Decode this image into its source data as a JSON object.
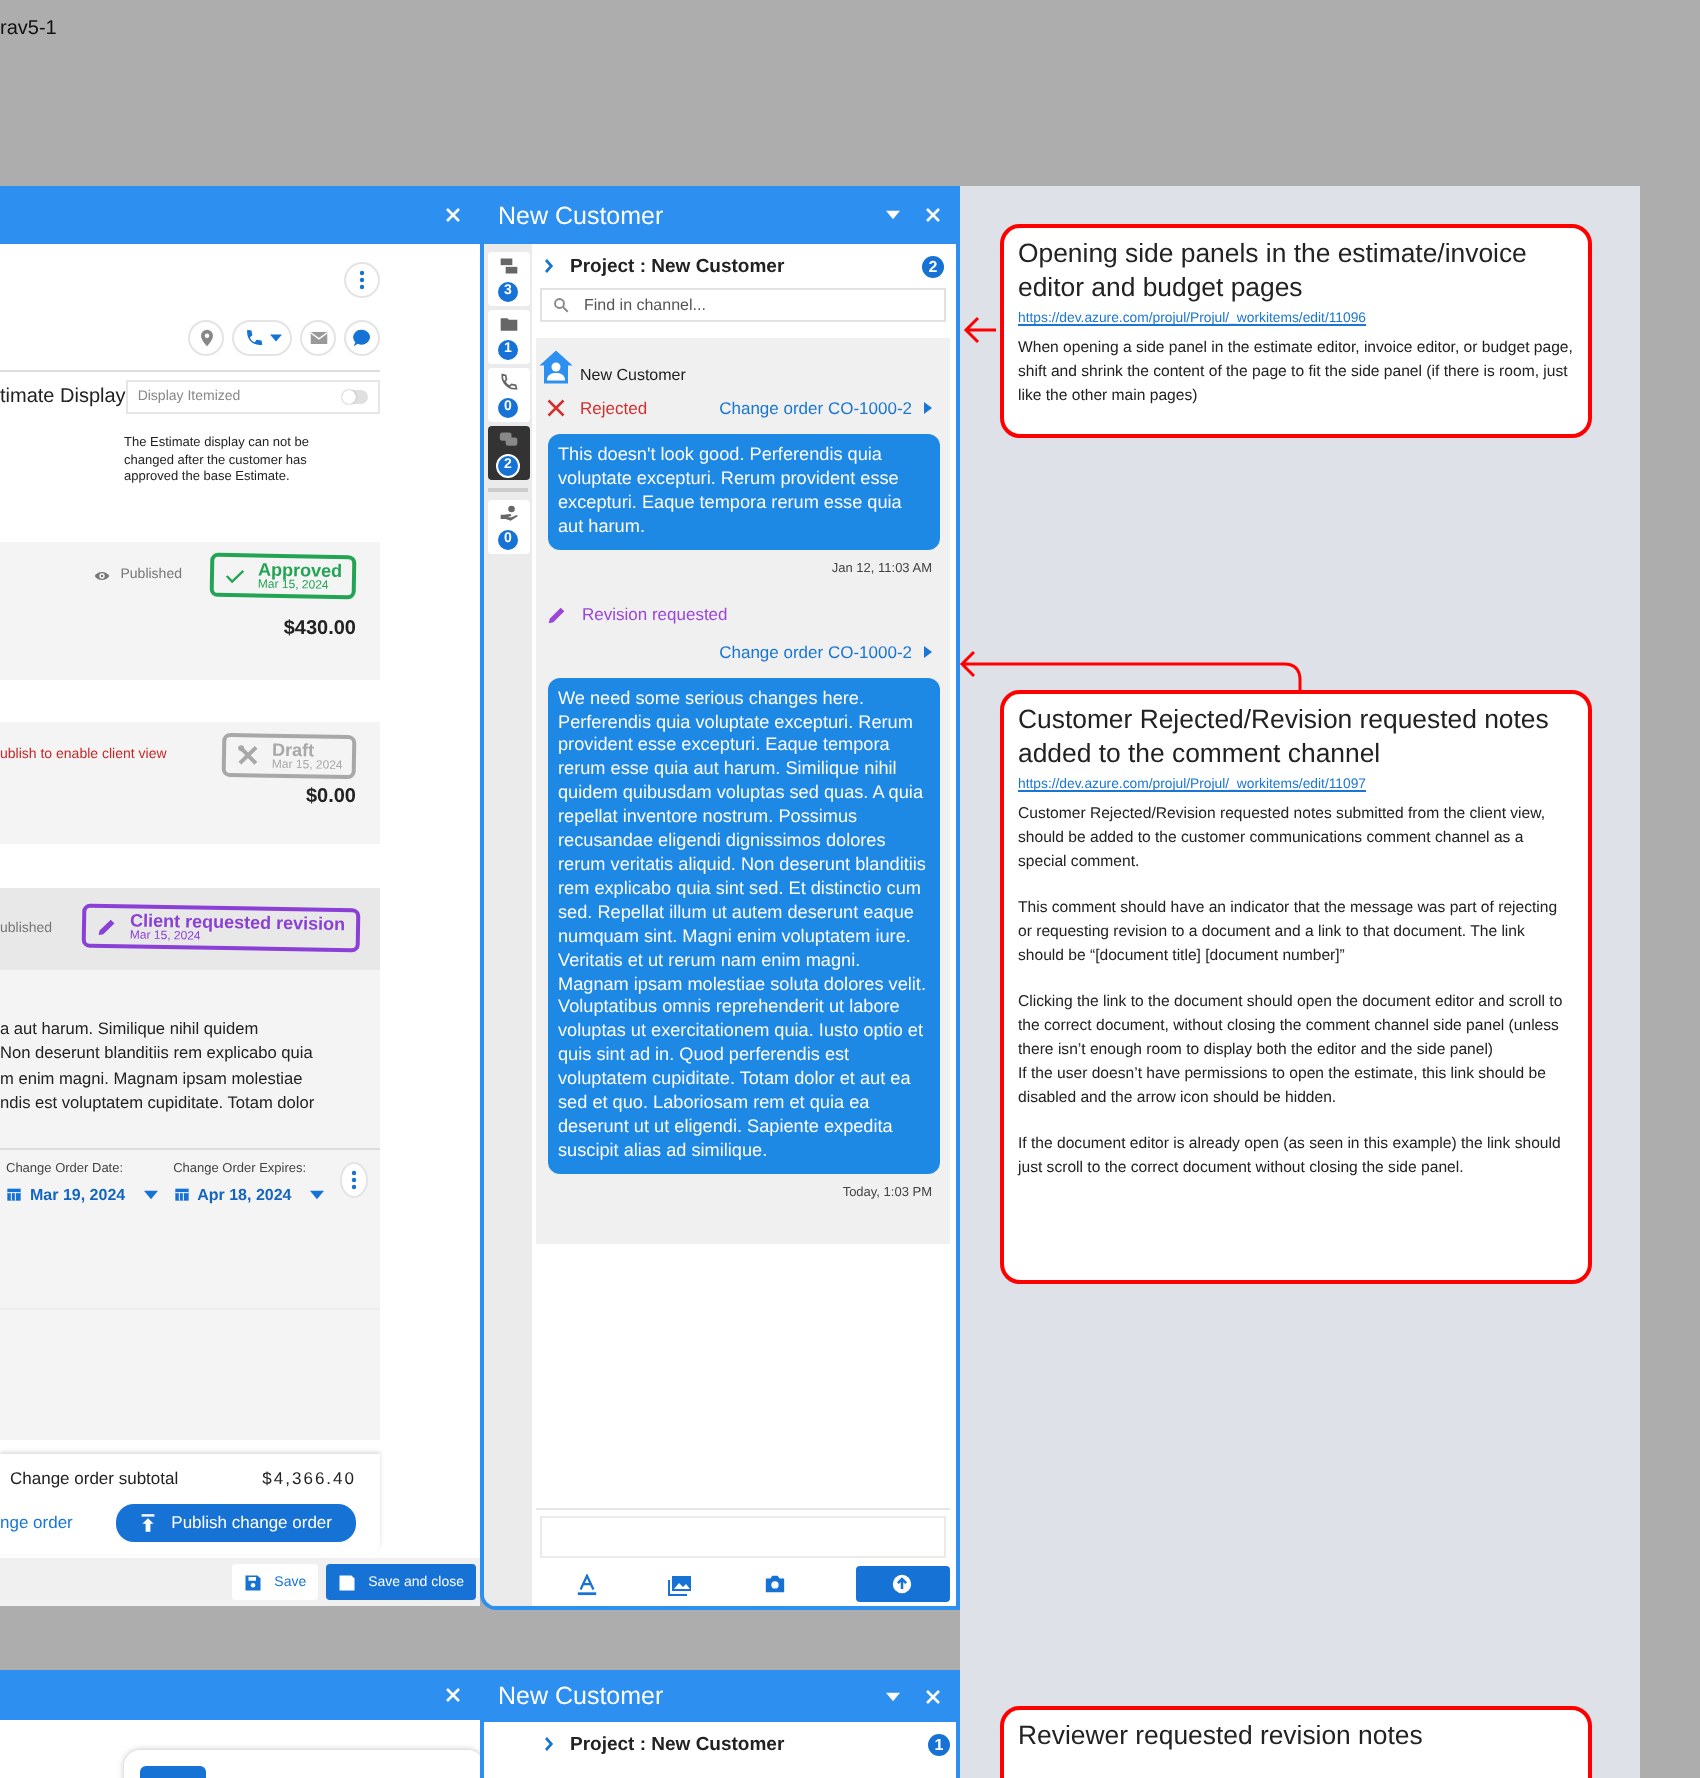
{
  "frame_label": "rav5-1",
  "editor": {
    "display_label": "timate Display",
    "display_toggle": {
      "label": "Display Itemized",
      "on": false
    },
    "display_note": "The Estimate display can not be changed after the customer has approved the base Estimate.",
    "cards": [
      {
        "kind": "published",
        "visibility": "Published",
        "stamp": {
          "kind": "approved",
          "label": "Approved",
          "date": "Mar 15, 2024"
        },
        "total": "$430.00"
      },
      {
        "kind": "unpublished",
        "warning": "ublish to enable client view",
        "stamp": {
          "kind": "draft",
          "label": "Draft",
          "date": "Mar 15, 2024"
        },
        "total": "$0.00"
      },
      {
        "kind": "change_order",
        "visibility": "ublished",
        "stamp": {
          "kind": "revision",
          "label": "Client requested revision",
          "date": "Mar 15, 2024"
        },
        "description_lines": [
          "a aut harum. Similique nihil quidem",
          "Non deserunt blanditiis rem explicabo quia",
          "m enim magni. Magnam ipsam molestiae",
          "ndis est voluptatem cupiditate. Totam dolor"
        ],
        "dates": [
          {
            "label": "Change Order Date:",
            "value": "Mar 19, 2024"
          },
          {
            "label": "Change Order Expires:",
            "value": "Apr 18, 2024"
          }
        ]
      }
    ],
    "footer": {
      "subtotal_label": "Change order subtotal",
      "subtotal": "$4,366.40",
      "link": "nge order",
      "publish_button": "Publish change order"
    },
    "actions": [
      {
        "kind": "secondary",
        "label": "Save"
      },
      {
        "kind": "primary",
        "label": "Save and close"
      }
    ]
  },
  "side_panel": {
    "title": "New Customer",
    "rail": [
      {
        "kind": "list",
        "count": "3",
        "selected": false
      },
      {
        "kind": "folder",
        "count": "1",
        "selected": false
      },
      {
        "kind": "calls",
        "count": "0",
        "selected": false
      },
      {
        "kind": "chat",
        "count": "2",
        "selected": true
      },
      {
        "kind": "payments",
        "count": "0",
        "selected": false
      }
    ],
    "project": "Project : New Customer",
    "project_count": "2",
    "search": {
      "placeholder": "Find in channel..."
    },
    "sender": "New Customer",
    "messages": [
      {
        "status": {
          "kind": "rejected",
          "label": "Rejected"
        },
        "link": "Change order CO-1000-2",
        "text": "This doesn't look good. Perferendis quia voluptate excepturi. Rerum provident esse excepturi. Eaque tempora rerum esse quia aut harum.",
        "time": "Jan 12, 11:03 AM"
      },
      {
        "status": {
          "kind": "revision",
          "label": "Revision requested"
        },
        "link": "Change order CO-1000-2",
        "text": "We need some serious changes here. Perferendis quia voluptate excepturi. Rerum provident esse excepturi. Eaque tempora rerum esse quia aut harum. Similique nihil quidem quibusdam voluptas sed quas. A quia repellat inventore nostrum. Possimus recusandae eligendi dignissimos dolores rerum veritatis aliquid. Non deserunt blanditiis rem explicabo quia sint sed. Et distinctio cum sed. Repellat illum ut autem deserunt eaque numquam sint. Magni enim voluptatem iure. Veritatis et ut rerum nam enim magni. Magnam ipsam molestiae soluta dolores velit. Voluptatibus omnis reprehenderit ut labore voluptas ut exercitationem quia. Iusto optio et quis sint ad in. Quod perferendis est voluptatem cupiditate. Totam dolor et aut ea sed et quo. Laboriosam rem et quia ea deserunt ut ut eligendi. Sapiente expedita suscipit alias ad similique.",
        "time": "Today, 1:03 PM"
      }
    ]
  },
  "annotations": [
    {
      "title": "Opening side panels in the estimate/invoice editor and budget pages",
      "link": "https://dev.azure.com/projul/Projul/_workitems/edit/11096",
      "paragraphs": [
        [
          "When opening a side panel in the estimate editor, invoice editor, or budget page, shift and shrink the content of the page to fit the side panel (if there is room, just like the other main pages)"
        ]
      ]
    },
    {
      "title": "Customer Rejected/Revision requested notes added to the comment channel",
      "link": "https://dev.azure.com/projul/Projul/_workitems/edit/11097",
      "paragraphs": [
        [
          "Customer Rejected/Revision requested notes submitted from the client view, should be added to the customer communications comment channel as a special comment."
        ],
        [
          "This comment should have an indicator that the message was part of rejecting or requesting revision to a document and a link to that document. The link should be “[document title] [document number]”"
        ],
        [
          "Clicking the link to the document should open the document editor and scroll to the correct document, without closing the comment channel side panel (unless there isn’t enough room to display both the editor and the side panel)",
          "If the user doesn’t have permissions to open the estimate, this link should be disabled and the arrow icon should be hidden."
        ],
        [
          "If the document editor is already open (as seen in this example) the link should just scroll to the correct document without closing the side panel."
        ]
      ]
    }
  ],
  "second_frame": {
    "side_panel": {
      "title": "New Customer",
      "project": "Project : New Customer",
      "project_count": "1"
    },
    "annotation": {
      "title": "Reviewer requested revision notes"
    }
  }
}
